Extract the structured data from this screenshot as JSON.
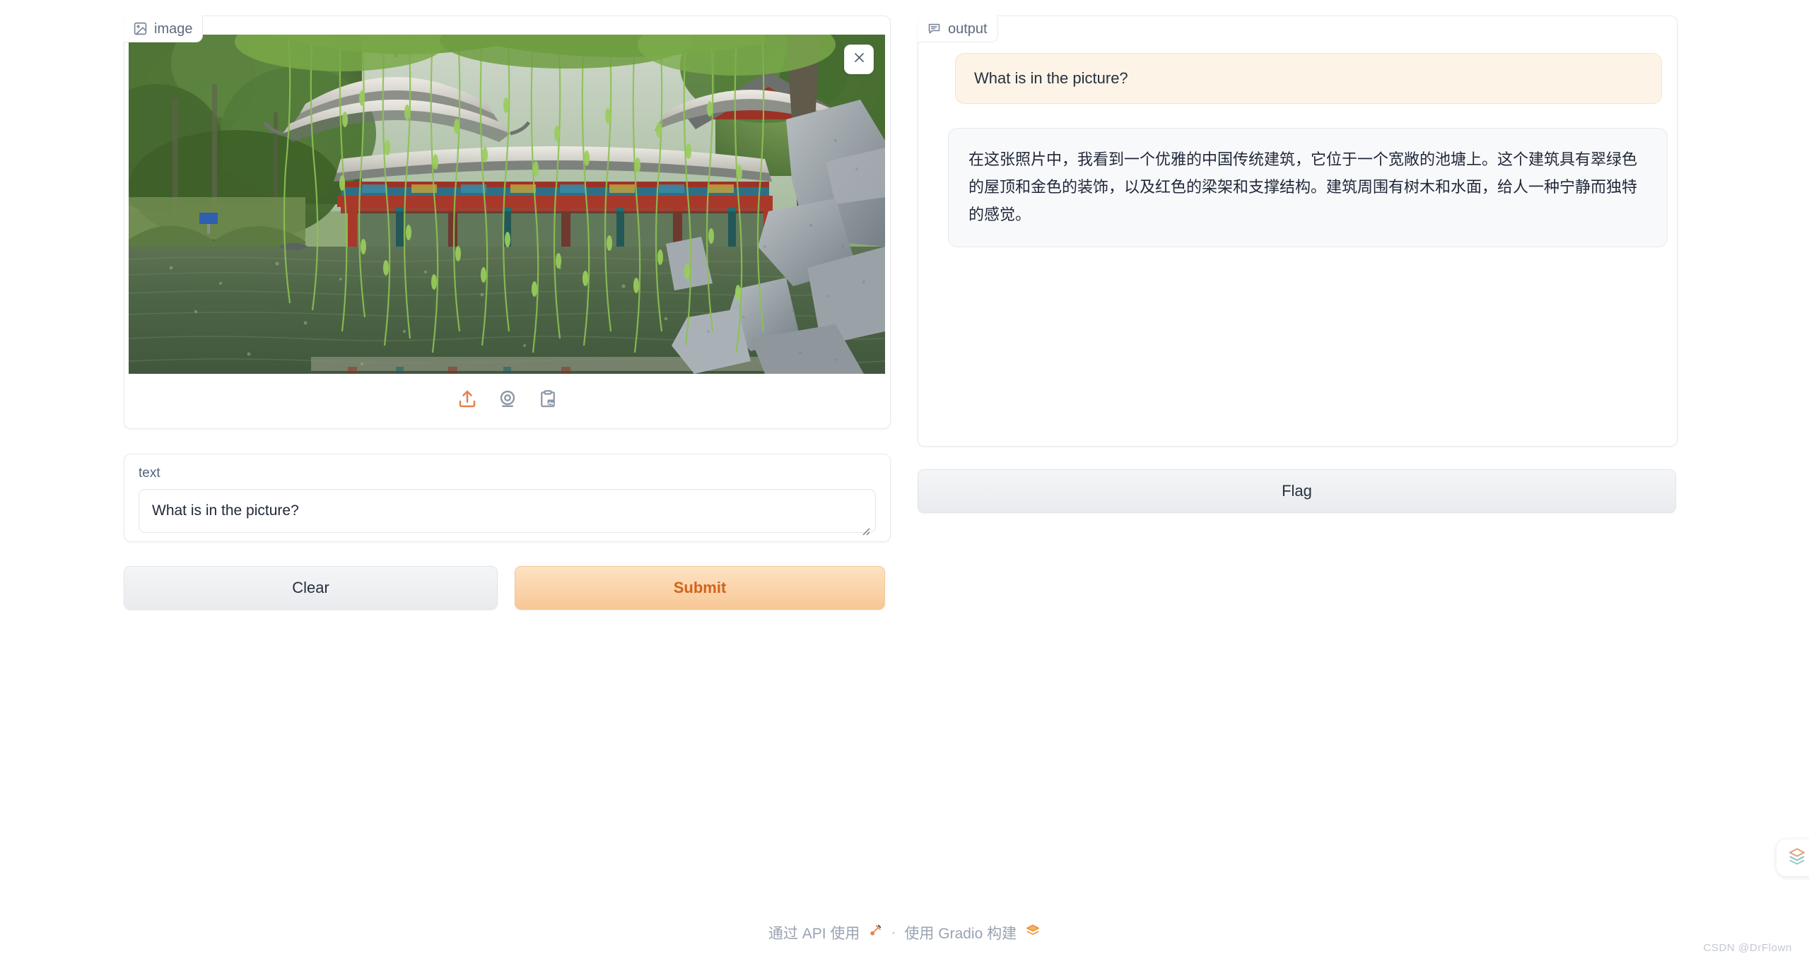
{
  "image_panel": {
    "label": "image",
    "label_icon": "image-icon",
    "close_icon": "close-icon",
    "photo_alt": "Traditional Chinese pavilion with teal-green tiled roof, gold ornament and red beams beside a wide pond, surrounded by willow trees and grey rock formations",
    "toolbar": [
      {
        "name": "upload-icon",
        "label": "Upload",
        "color": "#e8804a",
        "active": true
      },
      {
        "name": "webcam-icon",
        "label": "Webcam",
        "color": "#8d97a6",
        "active": false
      },
      {
        "name": "clipboard-paste-icon",
        "label": "Paste from clipboard",
        "color": "#8d97a6",
        "active": false
      }
    ]
  },
  "text_input": {
    "label": "text",
    "value": "What is in the picture?",
    "placeholder": "What is in the picture?"
  },
  "actions": {
    "clear_label": "Clear",
    "submit_label": "Submit"
  },
  "output_panel": {
    "label": "output",
    "label_icon": "chat-icon",
    "user_message": "What is in the picture?",
    "bot_message": "在这张照片中，我看到一个优雅的中国传统建筑，它位于一个宽敞的池塘上。这个建筑具有翠绿色的屋顶和金色的装饰，以及红色的梁架和支撑结构。建筑周围有树木和水面，给人一种宁静而独特的感觉。",
    "flag_label": "Flag"
  },
  "footer": {
    "api_text": "通过 API 使用",
    "api_icon": "plug-icon",
    "separator": "·",
    "built_text": "使用 Gradio 构建",
    "built_icon": "gradio-logo-icon"
  },
  "watermark": "CSDN @DrFlown",
  "corner_badge": {
    "icon": "layers-logo-icon"
  },
  "colors": {
    "page_background": "#ffffff",
    "panel_background": "#ffffff",
    "panel_border": "#e9eaed",
    "accent_orange": "#e8804a",
    "submit_text": "#d2641c",
    "user_bubble_bg": "#fdf3e7",
    "bot_bubble_bg": "#f8f9fb",
    "label_text": "#5c6b80",
    "body_text": "#1f2737"
  }
}
